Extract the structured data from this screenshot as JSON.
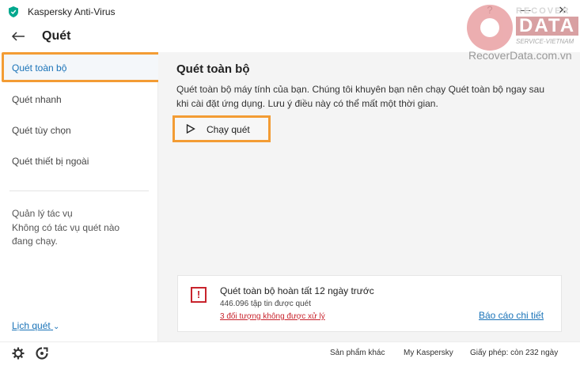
{
  "window": {
    "title": "Kaspersky Anti-Virus",
    "buttons": {
      "help": "?",
      "minimize": "—",
      "close": "✕"
    }
  },
  "header": {
    "title": "Quét"
  },
  "sidebar": {
    "items": [
      {
        "label": "Quét toàn bộ",
        "active": true
      },
      {
        "label": "Quét nhanh",
        "active": false
      },
      {
        "label": "Quét tùy chọn",
        "active": false
      },
      {
        "label": "Quét thiết bị ngoài",
        "active": false
      }
    ],
    "task_manager": {
      "title": "Quản lý tác vụ",
      "line1": "Không có tác vụ quét nào",
      "line2": "đang chạy."
    },
    "schedule_link": "Lịch quét",
    "schedule_chevron": "⌄"
  },
  "main": {
    "title": "Quét toàn bộ",
    "description": "Quét toàn bộ máy tính của bạn. Chúng tôi khuyên bạn nên chạy Quét toàn bộ ngay sau khi cài đặt ứng dụng. Lưu ý điều này có thể mất một thời gian.",
    "run_button": "Chạy quét",
    "status_card": {
      "warning_glyph": "!",
      "title": "Quét toàn bộ hoàn tất 12 ngày trước",
      "files_scanned": "446.096 tập tin được quét",
      "unprocessed_link": "3 đối tượng không được xử lý",
      "report_link": "Báo cáo chi tiết"
    }
  },
  "footer": {
    "links": {
      "other_products": "Sản phẩm khác",
      "my_kaspersky": "My Kaspersky",
      "license": "Giấy phép: còn 232 ngày"
    },
    "icons": [
      "gear-icon",
      "support-icon"
    ]
  },
  "watermark": {
    "recover": "RECOVER",
    "data": "DATA",
    "service": "SERVICE-VIETNAM",
    "domain": "RecoverData.com.vn"
  },
  "colors": {
    "accent_blue": "#1a73b8",
    "highlight_orange": "#f39c34",
    "warning_red": "#c8232c",
    "kaspersky_green": "#00a88e"
  }
}
